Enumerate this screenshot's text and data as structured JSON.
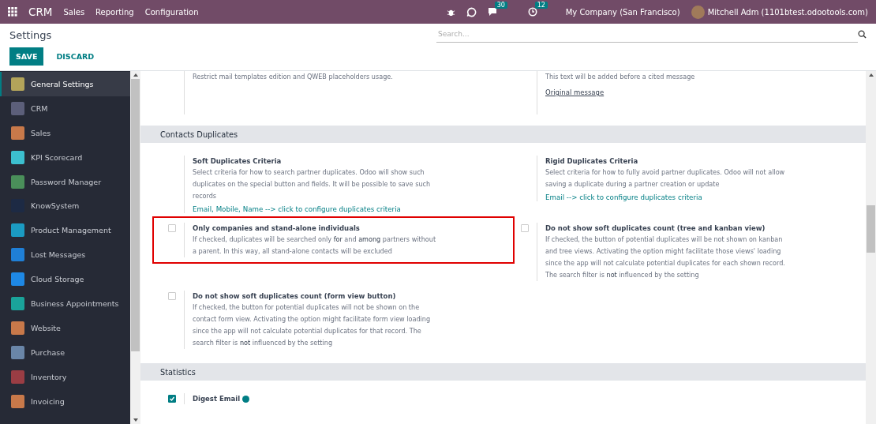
{
  "navbar": {
    "app": "CRM",
    "menus": [
      "Sales",
      "Reporting",
      "Configuration"
    ],
    "messages_count": "30",
    "activities_count": "12",
    "company": "My Company (San Francisco)",
    "user": "Mitchell Adm (1101btest.odootools.com)"
  },
  "control_panel": {
    "title": "Settings",
    "search": {
      "placeholder": "Search..."
    },
    "buttons": [
      {
        "label": "SAVE",
        "kind": "primary"
      },
      {
        "label": "DISCARD",
        "kind": "link"
      }
    ]
  },
  "sidebar": {
    "items": [
      {
        "label": "General Settings",
        "selected": true,
        "color": "#b3a45a"
      },
      {
        "label": "CRM",
        "selected": false,
        "color": "#5c5f7a"
      },
      {
        "label": "Sales",
        "selected": false,
        "color": "#c8794a"
      },
      {
        "label": "KPI Scorecard",
        "selected": false,
        "color": "#3cbfcf"
      },
      {
        "label": "Password Manager",
        "selected": false,
        "color": "#4a8f5a"
      },
      {
        "label": "KnowSystem",
        "selected": false,
        "color": "#1d2a44"
      },
      {
        "label": "Product Management",
        "selected": false,
        "color": "#1b9bc2"
      },
      {
        "label": "Lost Messages",
        "selected": false,
        "color": "#1f7fd6"
      },
      {
        "label": "Cloud Storage",
        "selected": false,
        "color": "#1e88e5"
      },
      {
        "label": "Business Appointments",
        "selected": false,
        "color": "#1aa39a"
      },
      {
        "label": "Website",
        "selected": false,
        "color": "#c8794a"
      },
      {
        "label": "Purchase",
        "selected": false,
        "color": "#6a86a8"
      },
      {
        "label": "Inventory",
        "selected": false,
        "color": "#9a3d44"
      },
      {
        "label": "Invoicing",
        "selected": false,
        "color": "#c8794a"
      }
    ]
  },
  "top_partial": [
    {
      "description": "Restrict mail templates edition and QWEB placeholders usage."
    },
    {
      "description": "This text will be added before a cited message",
      "link": "Original message"
    }
  ],
  "sections": [
    {
      "title": "Contacts Duplicates",
      "settings": [
        {
          "kind": "text",
          "title": "Soft Duplicates Criteria",
          "description": "Select criteria for how to search partner duplicates. Odoo will show such duplicates on the special button and fields. It will be possible to save such records",
          "link": "Email, Mobile, Name --> click to configure duplicates criteria",
          "highlighted": false
        },
        {
          "kind": "text",
          "title": "Rigid Duplicates Criteria",
          "description": "Select criteria for how to fully avoid partner duplicates. Odoo will not allow saving a duplicate during a partner creation or update",
          "link": "Email --> click to configure duplicates criteria",
          "highlighted": false
        },
        {
          "kind": "checkbox",
          "checked": false,
          "title": "Only companies and stand-alone individuals",
          "description": "If checked, duplicates will be searched only **for** and **among** partners without a parent. In this way, all stand-alone contacts will be excluded",
          "highlighted": true
        },
        {
          "kind": "checkbox",
          "checked": false,
          "title": "Do not show soft duplicates count (tree and kanban view)",
          "description": "If checked, the button of potential duplicates will be not shown on kanban and tree views. Activating the option might facilitate those views' loading since the app will not calculate potential duplicates for each shown record. The search filter is **not** influenced by the setting",
          "highlighted": false
        },
        {
          "kind": "checkbox",
          "checked": false,
          "title": "Do not show soft duplicates count (form view button)",
          "description": "If checked, the button for potential duplicates will not be shown on the contact form view. Activating the option might facilitate form view loading since the app will not calculate potential duplicates for that record. The search filter is **not** influenced by the setting",
          "highlighted": false
        }
      ]
    },
    {
      "title": "Statistics",
      "settings": [
        {
          "kind": "checkbox",
          "checked": true,
          "title": "Digest Email",
          "help": true,
          "highlighted": false
        }
      ]
    }
  ]
}
